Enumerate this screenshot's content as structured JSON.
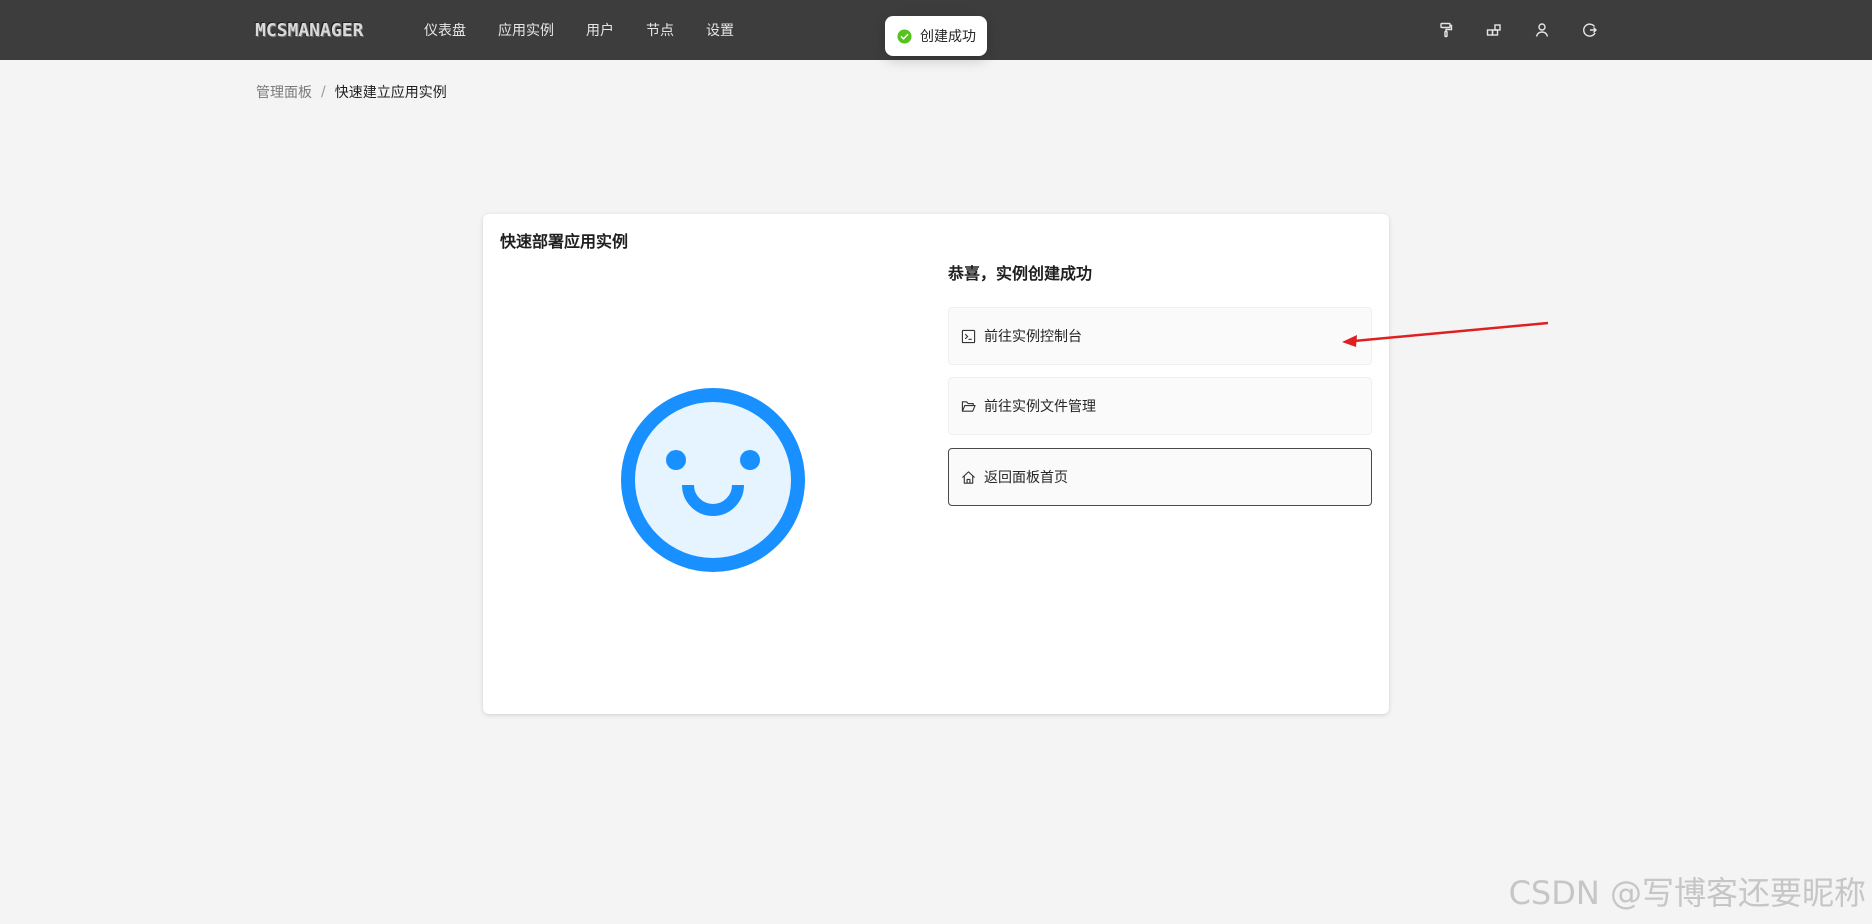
{
  "header": {
    "logo_text": "MCSMANAGER",
    "nav": [
      "仪表盘",
      "应用实例",
      "用户",
      "节点",
      "设置"
    ],
    "icons": [
      "paint-roller-icon",
      "blocks-icon",
      "user-icon",
      "logout-icon"
    ]
  },
  "toast": {
    "message": "创建成功",
    "icon": "check-circle-icon",
    "color": "#52c41a"
  },
  "breadcrumb": {
    "root": "管理面板",
    "separator": "/",
    "current": "快速建立应用实例"
  },
  "card": {
    "title": "快速部署应用实例",
    "success_title": "恭喜，实例创建成功",
    "actions": [
      {
        "label": "前往实例控制台",
        "icon": "terminal-icon"
      },
      {
        "label": "前往实例文件管理",
        "icon": "folder-open-icon"
      },
      {
        "label": "返回面板首页",
        "icon": "home-icon"
      }
    ],
    "illustration": "smiley-icon",
    "accent_color": "#1890ff"
  },
  "watermark": "CSDN @写博客还要昵称"
}
